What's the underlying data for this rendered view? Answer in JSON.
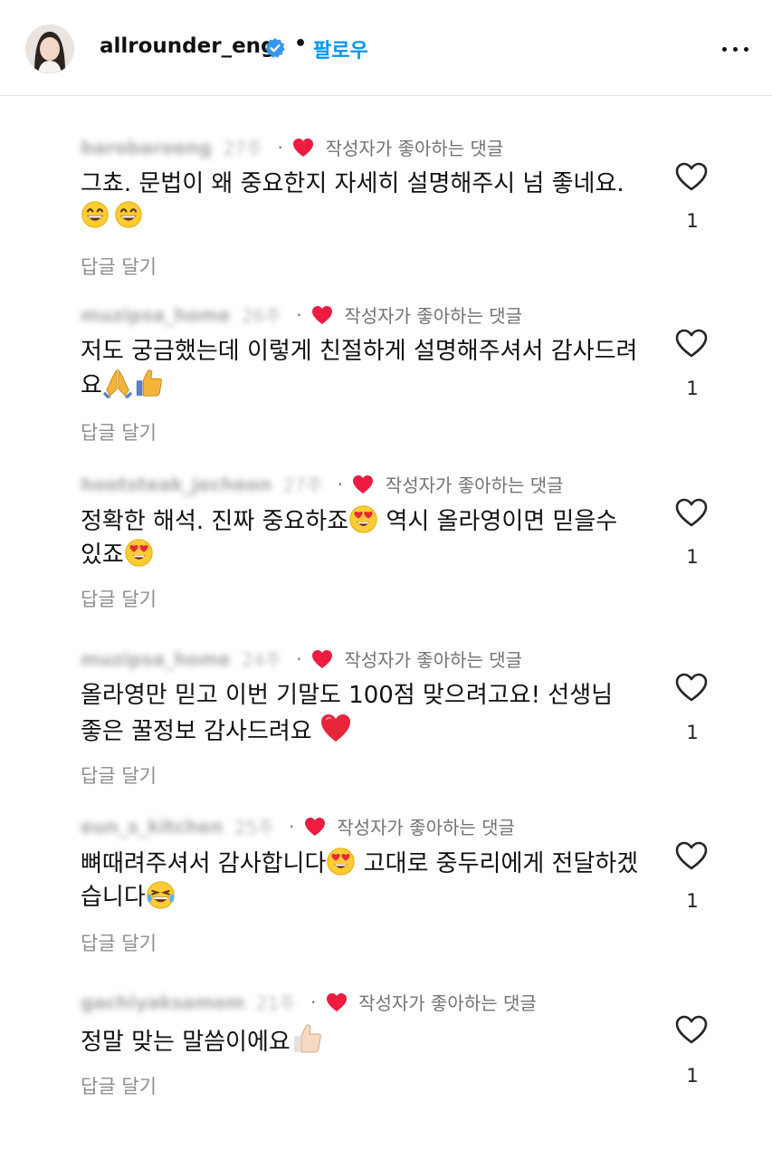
{
  "header": {
    "username": "allrounder_eng",
    "separator": "•",
    "follow_label": "팔로우"
  },
  "comments": [
    {
      "commenter": "barobaroeng",
      "age": "27주",
      "separator": "·",
      "liked_label": "작성자가 좋아하는 댓글",
      "text": "그쵸. 문법이 왜 중요한지 자세히 설명해주시 넘 좋네요.",
      "emojis": [
        "grinning-face",
        "grinning-face"
      ],
      "reply_label": "답글 달기",
      "like_count": "1"
    },
    {
      "commenter": "muzipsa_home",
      "age": "26주",
      "separator": "·",
      "liked_label": "작성자가 좋아하는 댓글",
      "text": "저도 궁금했는데 이렇게 친절하게 설명해주셔서 감사드려요",
      "emojis": [
        "folded-hands",
        "thumbs-up"
      ],
      "reply_label": "답글 달기",
      "like_count": "1"
    },
    {
      "commenter": "hootsteak_jecheon",
      "age": "27주",
      "separator": "·",
      "liked_label": "작성자가 좋아하는 댓글",
      "text_a": "정확한 해석. 진짜 중요하죠",
      "text_b": " 역시 올라영이면 믿을수 있죠",
      "emojis": [
        "heart-eyes",
        "heart-eyes"
      ],
      "reply_label": "답글 달기",
      "like_count": "1"
    },
    {
      "commenter": "muzipsa_home",
      "age": "24주",
      "separator": "·",
      "liked_label": "작성자가 좋아하는 댓글",
      "text": "올라영만 믿고 이번 기말도 100점 맞으려고요! 선생님 좋은 꿀정보 감사드려요",
      "emojis": [
        "red-heart"
      ],
      "reply_label": "답글 달기",
      "like_count": "1"
    },
    {
      "commenter": "eun_s_kitchen",
      "age": "25주",
      "separator": "·",
      "liked_label": "작성자가 좋아하는 댓글",
      "text_a": "뼈때려주셔서 감사합니다",
      "text_b": " 고대로 중두리에게 전달하겠습니다",
      "emojis": [
        "heart-eyes",
        "tears-of-joy"
      ],
      "reply_label": "답글 달기",
      "like_count": "1"
    },
    {
      "commenter": "gachiyaksamom",
      "age": "21주",
      "separator": "·",
      "liked_label": "작성자가 좋아하는 댓글",
      "text": "정말 맞는 말씀이에요",
      "emojis": [
        "thumbs-up-light"
      ],
      "reply_label": "답글 달기",
      "like_count": "1"
    }
  ],
  "colors": {
    "follow_blue": "#0095f6",
    "verified_blue": "#3897f0",
    "liked_heart_red": "#ed1c40",
    "muted_text": "#8e8e8e"
  }
}
